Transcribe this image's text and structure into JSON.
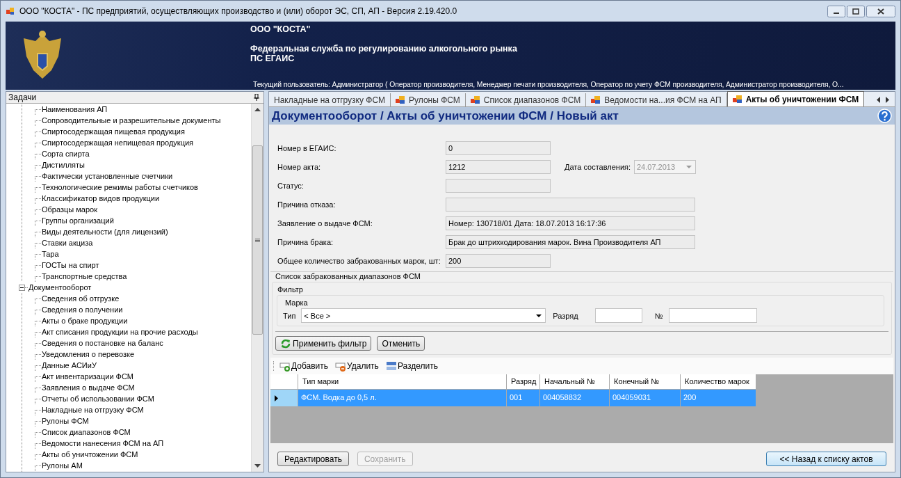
{
  "window": {
    "title": "ООО \"КОСТА\" - ПС предприятий, осуществляющих производство и (или) оборот ЭС, СП, АП - Версия 2.19.420.0"
  },
  "header": {
    "organization": "ООО \"КОСТА\"",
    "agency": "Федеральная служба по регулированию алкогольного рынка",
    "system": "ПС ЕГАИС",
    "current_user": "Текущий пользователь: Администратор ( Оператор производителя, Менеджер печати производителя, Оператор по учету ФСМ производителя, Администратор производителя, О..."
  },
  "sidebar": {
    "title": "Задачи",
    "tree": [
      {
        "children": [
          {
            "label": "Наименования АП"
          },
          {
            "label": "Сопроводительные и разрешительные документы"
          },
          {
            "label": "Спиртосодержащая пищевая продукция"
          },
          {
            "label": "Спиртосодержащая непищевая продукция"
          },
          {
            "label": "Сорта спирта"
          },
          {
            "label": "Дистилляты"
          },
          {
            "label": "Фактически установленные счетчики"
          },
          {
            "label": "Технологические режимы работы счетчиков"
          },
          {
            "label": "Классификатор видов продукции"
          },
          {
            "label": "Образцы марок"
          },
          {
            "label": "Группы организаций"
          },
          {
            "label": "Виды деятельности (для лицензий)"
          },
          {
            "label": "Ставки акциза"
          },
          {
            "label": "Тара"
          },
          {
            "label": "ГОСТы на спирт"
          },
          {
            "label": "Транспортные средства"
          }
        ]
      },
      {
        "label": "Документооборот",
        "expanded": true,
        "children": [
          {
            "label": "Сведения об отгрузке"
          },
          {
            "label": "Сведения о получении"
          },
          {
            "label": "Акты о браке продукции"
          },
          {
            "label": "Акт списания продукции на прочие расходы"
          },
          {
            "label": "Сведения о постановке на баланс"
          },
          {
            "label": "Уведомления о перевозке"
          },
          {
            "label": "Данные АСИиУ"
          },
          {
            "label": "Акт инвентаризации ФСМ"
          },
          {
            "label": "Заявления о выдаче ФСМ"
          },
          {
            "label": "Отчеты об использовании ФСМ"
          },
          {
            "label": "Накладные на отгрузку ФСМ"
          },
          {
            "label": "Рулоны ФСМ"
          },
          {
            "label": "Список диапазонов ФСМ"
          },
          {
            "label": "Ведомости нанесения ФСМ на АП"
          },
          {
            "label": "Акты об уничтожении ФСМ"
          },
          {
            "label": "Рулоны АМ"
          }
        ]
      }
    ]
  },
  "tabs": [
    {
      "label": "Накладные на отгрузку ФСМ",
      "selected": false,
      "icon": false
    },
    {
      "label": "Рулоны ФСМ",
      "selected": false,
      "icon": true
    },
    {
      "label": "Список диапазонов ФСМ",
      "selected": false,
      "icon": true
    },
    {
      "label": "Ведомости на...ия ФСМ на АП",
      "selected": false,
      "icon": true
    },
    {
      "label": "Акты об уничтожении ФСМ",
      "selected": true,
      "icon": true
    }
  ],
  "page_title": "Документооборот / Акты об уничтожении ФСМ / Новый акт",
  "form": {
    "fields": [
      {
        "label": "Номер в ЕГАИС:",
        "value": "0",
        "kind": "short"
      },
      {
        "label": "Номер акта:",
        "value": "1212",
        "kind": "short",
        "date": {
          "label": "Дата составления:",
          "value": "24.07.2013",
          "disabled": true
        }
      },
      {
        "label": "Статус:",
        "kind": "short"
      },
      {
        "label": "Причина отказа:",
        "kind": "long"
      },
      {
        "label": "Заявление о выдаче ФСМ:",
        "value": "Номер: 130718/01 Дата: 18.07.2013 16:17:36",
        "kind": "long"
      },
      {
        "label": "Причина брака:",
        "value": "Брак до штрихкодирования марок. Вина Производителя АП",
        "kind": "long"
      },
      {
        "label": "Общее количество забракованных марок, шт:",
        "value": "200",
        "kind": "short"
      }
    ]
  },
  "ranges": {
    "title": "Список забракованных диапазонов ФСМ",
    "filter": {
      "title": "Фильтр",
      "group": "Марка",
      "type_label": "Тип",
      "type_value": "< Все >",
      "digit_label": "Разряд",
      "number_label": "№",
      "apply": "Применить фильтр",
      "cancel": "Отменить"
    },
    "toolbar": [
      {
        "label": "Добавить",
        "kind": "add"
      },
      {
        "label": "Удалить",
        "kind": "delete"
      },
      {
        "label": "Разделить",
        "kind": "split"
      }
    ],
    "table": {
      "columns": [
        "Тип марки",
        "Разряд",
        "Начальный №",
        "Конечный №",
        "Количество марок"
      ],
      "rows": [
        {
          "selected": true,
          "cells": [
            "ФСМ. Водка до 0,5 л.",
            "001",
            "004058832",
            "004059031",
            "200"
          ]
        }
      ]
    }
  },
  "buttons": [
    {
      "label": "Редактировать",
      "disabled": false
    },
    {
      "label": "Сохранить",
      "disabled": true
    }
  ],
  "back_button": "<< Назад к списку актов"
}
